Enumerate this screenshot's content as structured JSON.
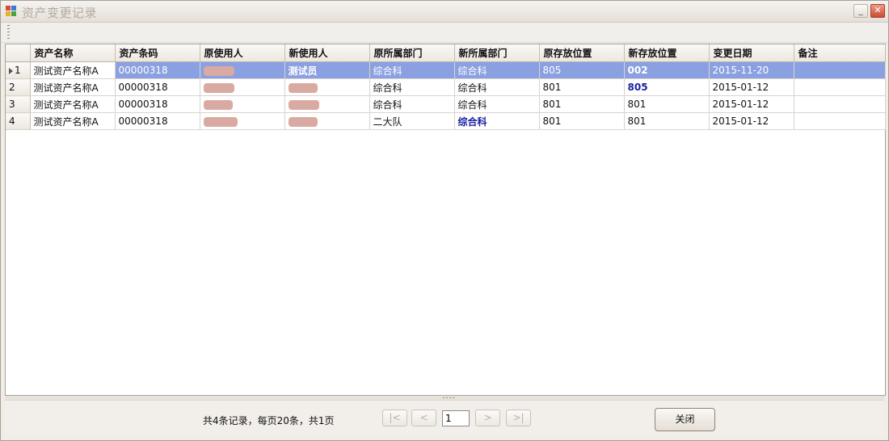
{
  "window": {
    "title": "资产变更记录"
  },
  "columns": [
    "资产名称",
    "资产条码",
    "原使用人",
    "新使用人",
    "原所属部门",
    "新所属部门",
    "原存放位置",
    "新存放位置",
    "变更日期",
    "备注"
  ],
  "rows": [
    {
      "num": "1",
      "name": "测试资产名称A",
      "barcode": "00000318",
      "old_user": "",
      "new_user": "测试员",
      "old_dept": "综合科",
      "new_dept": "综合科",
      "old_loc": "805",
      "new_loc": "002",
      "date": "2015-11-20",
      "remark": ""
    },
    {
      "num": "2",
      "name": "测试资产名称A",
      "barcode": "00000318",
      "old_user": "",
      "new_user": "",
      "old_dept": "综合科",
      "new_dept": "综合科",
      "old_loc": "801",
      "new_loc": "805",
      "date": "2015-01-12",
      "remark": ""
    },
    {
      "num": "3",
      "name": "测试资产名称A",
      "barcode": "00000318",
      "old_user": "",
      "new_user": "",
      "old_dept": "综合科",
      "new_dept": "综合科",
      "old_loc": "801",
      "new_loc": "801",
      "date": "2015-01-12",
      "remark": ""
    },
    {
      "num": "4",
      "name": "测试资产名称A",
      "barcode": "00000318",
      "old_user": "",
      "new_user": "",
      "old_dept": "二大队",
      "new_dept": "综合科",
      "old_loc": "801",
      "new_loc": "801",
      "date": "2015-01-12",
      "remark": ""
    }
  ],
  "footer": {
    "record_info": "共4条记录，每页20条，共1页",
    "first_label": "|<",
    "prev_label": "<",
    "page_value": "1",
    "next_label": ">",
    "last_label": ">|",
    "close_label": "关闭"
  },
  "icons": {
    "app": "app-window-icon",
    "minimize": "minimize-icon",
    "close": "close-icon",
    "row_pointer": "row-pointer-icon"
  },
  "colors": {
    "selection": "#8aa0e0",
    "changed_value": "#1b1fa0"
  }
}
